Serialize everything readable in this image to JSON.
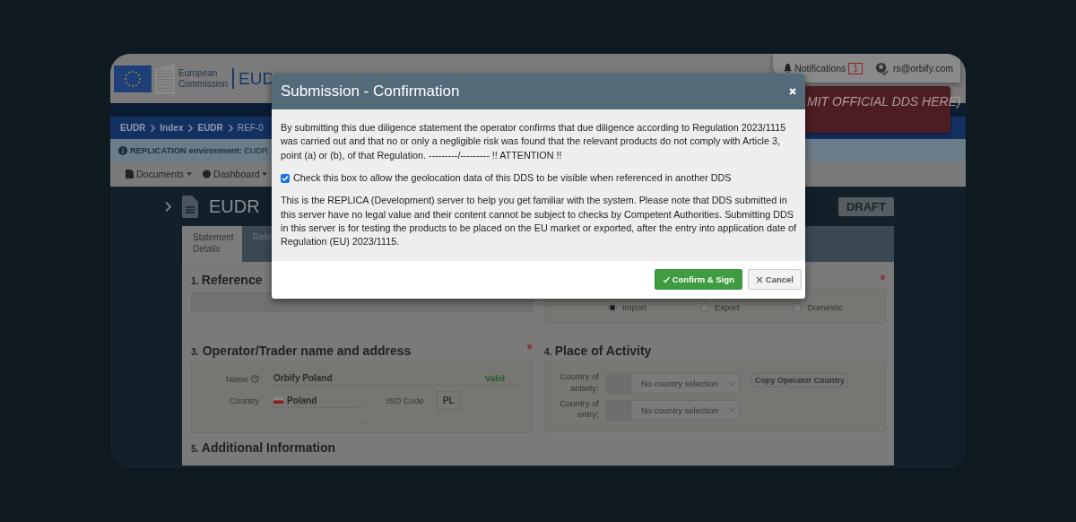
{
  "header": {
    "org_lines": [
      "European",
      "Commission"
    ],
    "app_title": "EUD",
    "notifications": {
      "label": "Notifications",
      "count": "1"
    },
    "user": "rs@orbify.com",
    "banner": "MIT OFFICIAL DDS HERE)"
  },
  "breadcrumb": [
    "EUDR",
    "Index",
    "EUDR",
    "REF-0"
  ],
  "info_bar": {
    "label": "REPLICATION environment:",
    "text": "EUDR"
  },
  "toolbar": [
    {
      "label": "Documents"
    },
    {
      "label": "Dashboard"
    }
  ],
  "page": {
    "title": "EUDR",
    "status": "DRAFT"
  },
  "tabs": [
    {
      "label": "Statement Details",
      "selected": true
    },
    {
      "label": "Refe",
      "selected": false
    }
  ],
  "reference": {
    "number": "1.",
    "title": "Reference"
  },
  "activity": {
    "required_mark": "*",
    "options": [
      {
        "label": "Import",
        "selected": true
      },
      {
        "label": "Export",
        "selected": false
      },
      {
        "label": "Domestic",
        "selected": false
      }
    ]
  },
  "operator": {
    "number": "3.",
    "title": "Operator/Trader name and address",
    "required_mark": "*",
    "name_label": "Name",
    "name": "Orbify Poland",
    "status": "Valid",
    "country_label": "Country",
    "country": "Poland",
    "iso_label": "ISO Code",
    "iso": "PL",
    "more": "..."
  },
  "place": {
    "number": "4.",
    "title": "Place of Activity",
    "rows": [
      {
        "label": "Country of activity:",
        "value": "No country selection"
      },
      {
        "label": "Country of entry:",
        "value": "No country selection"
      }
    ],
    "copy_button": "Copy Operator Country"
  },
  "additional": {
    "number": "5.",
    "title": "Additional Information"
  },
  "modal": {
    "title": "Submission - Confirmation",
    "intro": "By submitting this due diligence statement the operator confirms that due diligence according to Regulation 2023/1115 was carried out and that no or only a negligible risk was found that the relevant products do not comply with Article 3, point (a) or (b), of that Regulation. ---------/--------- !! ATTENTION !!",
    "checkbox": {
      "label": "Check this box to allow the geolocation data of this DDS to be visible when referenced in another DDS",
      "checked": true
    },
    "note": "This is the REPLICA (Development) server to help you get familiar with the system. Please note that DDS submitted in this server have no legal value and their content cannot be subject to checks by Competent Authorities. Submitting DDS in this server is for testing the products to be placed on the EU market or exported, after the entry into application date of Regulation (EU) 2023/1115.",
    "buttons": [
      {
        "label": "Confirm & Sign",
        "kind": "primary"
      },
      {
        "label": "Cancel",
        "kind": "default"
      }
    ]
  }
}
